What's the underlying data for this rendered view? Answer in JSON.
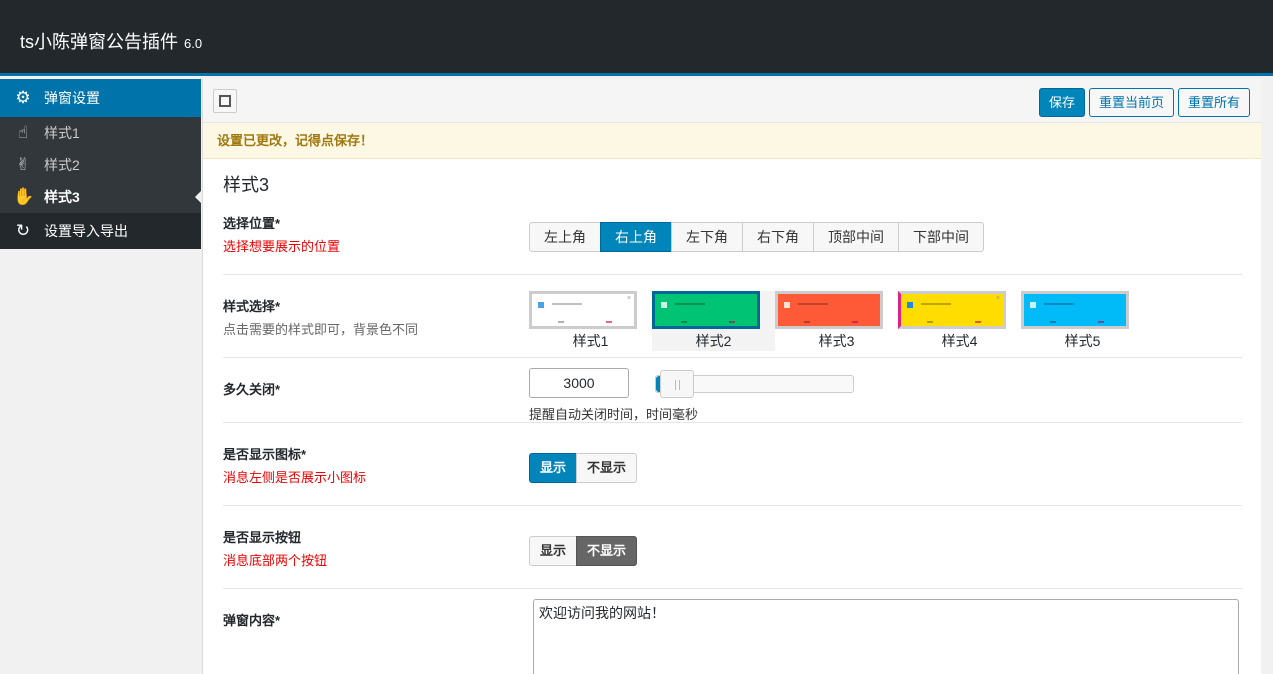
{
  "header": {
    "title": "ts小陈弹窗公告插件",
    "version": "6.0"
  },
  "sidebar": {
    "section": {
      "label": "弹窗设置",
      "icon": "gear-icon"
    },
    "items": [
      {
        "label": "样式1",
        "icon": "hand-pointer-icon"
      },
      {
        "label": "样式2",
        "icon": "hand-peace-icon"
      },
      {
        "label": "样式3",
        "icon": "hand-paper-icon"
      },
      {
        "label": "设置导入导出",
        "icon": "refresh-icon"
      }
    ],
    "active_index": 2
  },
  "toolbar": {
    "save": "保存",
    "reset_page": "重置当前页",
    "reset_all": "重置所有"
  },
  "notice": "设置已更改，记得点保存！",
  "section_title": "样式3",
  "fields": {
    "position": {
      "label": "选择位置*",
      "desc": "选择想要展示的位置",
      "options": [
        "左上角",
        "右上角",
        "左下角",
        "右下角",
        "顶部中间",
        "下部中间"
      ],
      "selected": "右上角"
    },
    "style": {
      "label": "样式选择*",
      "desc": "点击需要的样式即可，背景色不同",
      "options": [
        {
          "label": "样式1",
          "color": "#ffffff"
        },
        {
          "label": "样式2",
          "color": "#00c374"
        },
        {
          "label": "样式3",
          "color": "#ff5a37"
        },
        {
          "label": "样式4",
          "color": "#ffdd00"
        },
        {
          "label": "样式5",
          "color": "#00bbf8"
        }
      ],
      "selected": "样式2"
    },
    "close_delay": {
      "label": "多久关闭*",
      "value": "3000",
      "hint": "提醒自动关闭时间，时间毫秒",
      "slider_fraction": 0.03
    },
    "show_icon": {
      "label": "是否显示图标*",
      "desc": "消息左侧是否展示小图标",
      "options": [
        "显示",
        "不显示"
      ],
      "selected": "显示"
    },
    "show_buttons": {
      "label": "是否显示按钮",
      "desc": "消息底部两个按钮",
      "options": [
        "显示",
        "不显示"
      ],
      "selected": "不显示"
    },
    "content": {
      "label": "弹窗内容*",
      "value": "欢迎访问我的网站！"
    }
  }
}
